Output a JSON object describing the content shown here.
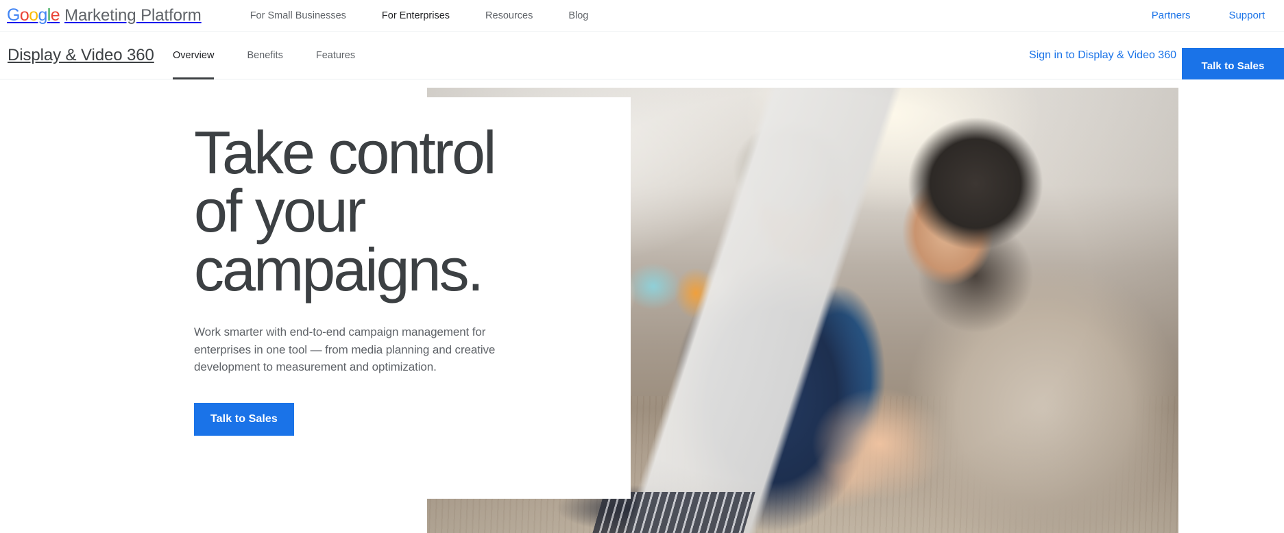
{
  "topbar": {
    "logo": {
      "word": "Google",
      "letters": [
        {
          "ch": "G",
          "color": "#4285F4"
        },
        {
          "ch": "o",
          "color": "#EA4335"
        },
        {
          "ch": "o",
          "color": "#FBBC05"
        },
        {
          "ch": "g",
          "color": "#4285F4"
        },
        {
          "ch": "l",
          "color": "#34A853"
        },
        {
          "ch": "e",
          "color": "#EA4335"
        }
      ],
      "suffix": "Marketing Platform"
    },
    "nav": [
      {
        "label": "For Small Businesses",
        "active": false
      },
      {
        "label": "For Enterprises",
        "active": true
      },
      {
        "label": "Resources",
        "active": false
      },
      {
        "label": "Blog",
        "active": false
      }
    ],
    "right_links": [
      {
        "label": "Partners"
      },
      {
        "label": "Support"
      }
    ]
  },
  "subbar": {
    "product_title": "Display & Video 360",
    "tabs": [
      {
        "label": "Overview",
        "active": true
      },
      {
        "label": "Benefits",
        "active": false
      },
      {
        "label": "Features",
        "active": false
      }
    ],
    "signin_label": "Sign in to Display & Video 360",
    "cta_label": "Talk to Sales"
  },
  "hero": {
    "headline": "Take control\nof your\ncampaigns.",
    "subtext": "Work smarter with end-to-end campaign management for enterprises in one tool — from media planning and creative development to measurement and optimization.",
    "cta_label": "Talk to Sales",
    "photo_alt": "Two colleagues reviewing a laptop at a desk"
  },
  "colors": {
    "brand_blue": "#1a73e8",
    "link_blue": "#1a73e8",
    "text_primary": "#3c4043",
    "text_secondary": "#5f6368",
    "border": "#eceff1",
    "surface": "#ffffff"
  }
}
